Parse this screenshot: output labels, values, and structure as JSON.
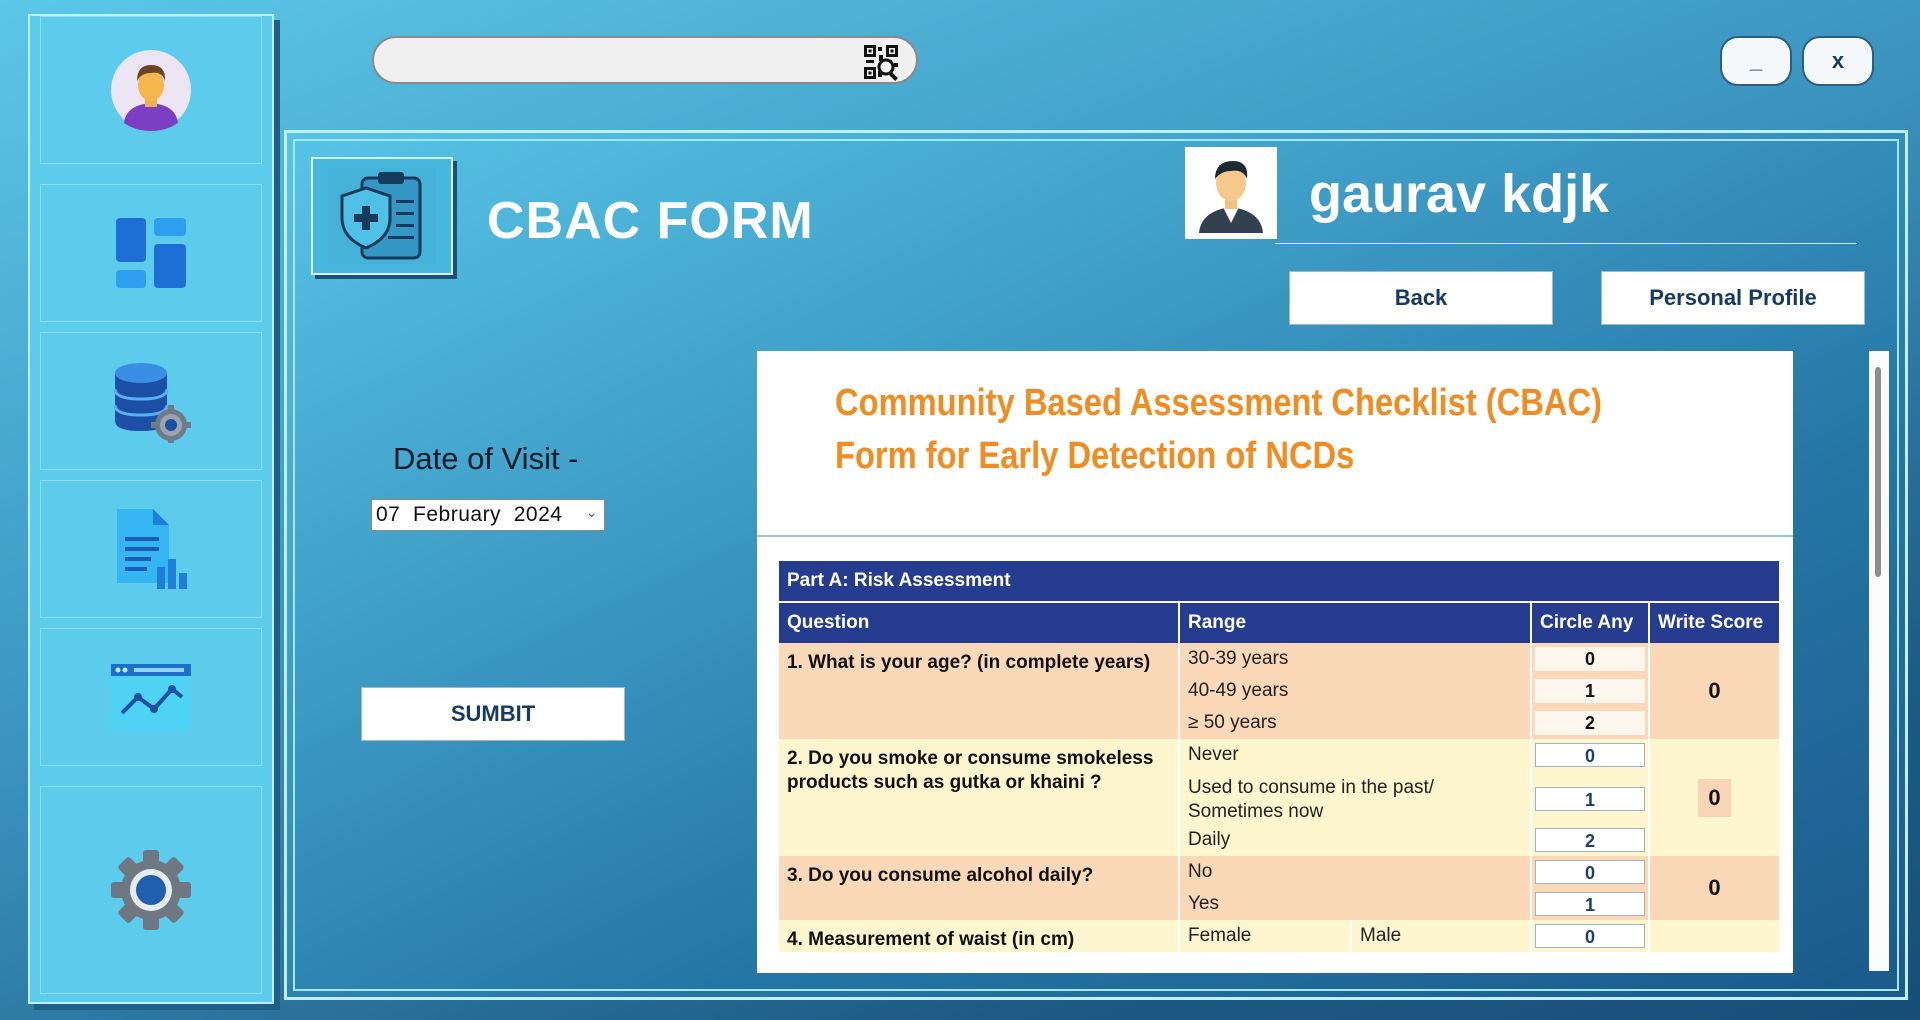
{
  "search": {
    "value": "",
    "placeholder": "",
    "qr_icon": "qr-code-scan-icon"
  },
  "window_controls": {
    "minimize_label": "_",
    "close_label": "x"
  },
  "sidebar": {
    "items": [
      {
        "icon": "user-avatar-icon"
      },
      {
        "icon": "dashboard-icon"
      },
      {
        "icon": "database-settings-icon"
      },
      {
        "icon": "report-document-icon"
      },
      {
        "icon": "analytics-chart-icon"
      },
      {
        "icon": "settings-gear-icon"
      }
    ]
  },
  "header": {
    "title": "CBAC FORM",
    "user_name": "gaurav kdjk",
    "back_label": "Back",
    "profile_label": "Personal Profile"
  },
  "visit": {
    "date_label": "Date of Visit -",
    "day": "07",
    "month": "February",
    "year": "2024",
    "submit_label": "SUMBIT"
  },
  "document": {
    "title_line1": "Community Based Assessment Checklist (CBAC)",
    "title_line2": "Form for Early Detection of NCDs",
    "part_a": "Part A: Risk Assessment",
    "columns": [
      "Question",
      "Range",
      "Circle Any",
      "Write Score"
    ],
    "q1": {
      "question": "1. What is your age? (in complete years)",
      "ranges": [
        "30-39 years",
        "40-49 years",
        "≥ 50 years"
      ],
      "values": [
        "0",
        "1",
        "2"
      ],
      "score": "0"
    },
    "q2": {
      "question": "2. Do you smoke or consume smokeless products such as gutka or khaini ?",
      "ranges": [
        "Never",
        "Used to consume in the past/ Sometimes now",
        "Daily"
      ],
      "values": [
        "0",
        "1",
        "2"
      ],
      "score": "0"
    },
    "q3": {
      "question": "3. Do you consume alcohol daily?",
      "ranges": [
        "No",
        "Yes"
      ],
      "values": [
        "0",
        "1"
      ],
      "score": "0"
    },
    "q4": {
      "question": "4. Measurement of waist (in cm)",
      "ranges": [
        "Female",
        "Male"
      ],
      "values": [
        "0"
      ]
    }
  },
  "colors": {
    "accent_orange": "#ef8c22",
    "table_header": "#263c8f",
    "peach_row": "#fbd8b8",
    "cream_row": "#fdf6cf"
  }
}
